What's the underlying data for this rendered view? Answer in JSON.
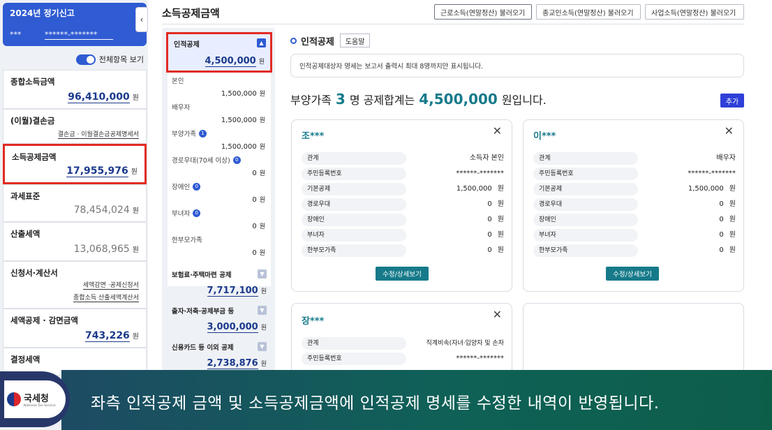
{
  "sidebar": {
    "year_title": "2024년 정기신고",
    "masked_name": "***",
    "masked_id": "******-*******",
    "toggle_label": "전체항목 보기",
    "collapse_glyph": "‹",
    "items": [
      {
        "label": "종합소득금액",
        "amount": "96,410,000",
        "unit": "원"
      },
      {
        "label": "(이월)결손금",
        "sub": "결손금 · 이월결손금공제명세서"
      },
      {
        "label": "소득공제금액",
        "amount": "17,955,976",
        "unit": "원"
      },
      {
        "label": "과세표준",
        "amount": "78,454,024",
        "unit": "원"
      },
      {
        "label": "산출세액",
        "amount": "13,068,965",
        "unit": "원"
      },
      {
        "label": "신청서·계산서",
        "sub1": "세액감면 ·공제신청서",
        "sub2": "종합소득 산출세액계산서"
      },
      {
        "label": "세액공제 · 감면금액",
        "amount": "743,226",
        "unit": "원"
      },
      {
        "label": "결정세액"
      }
    ]
  },
  "header": {
    "title": "소득공제금액",
    "btn1": "근로소득(연말정산) 불러오기",
    "btn2": "종교인소득(연말정산) 불러오기",
    "btn3": "사업소득(연말정산) 불러오기"
  },
  "mid": {
    "head_title": "인적공제",
    "head_amount": "4,500,000",
    "unit": "원",
    "up_glyph": "▲",
    "down_glyph": "▼",
    "subs": [
      {
        "label": "본인",
        "value": "1,500,000"
      },
      {
        "label": "배우자",
        "value": "1,500,000"
      },
      {
        "label": "부양가족",
        "badge": "1",
        "value": "1,500,000"
      },
      {
        "label": "경로우대(70세 이상)",
        "badge": "0",
        "value": "0"
      },
      {
        "label": "장애인",
        "badge": "0",
        "value": "0"
      },
      {
        "label": "부녀자",
        "badge": "0",
        "value": "0"
      },
      {
        "label": "한부모가족",
        "value": "0"
      }
    ],
    "cats": [
      {
        "label": "보험료·주택마련 공제",
        "value": "7,717,100"
      },
      {
        "label": "출자·저축·공제부금 등",
        "value": "3,000,000"
      },
      {
        "label": "신용카드 등 이외 공제",
        "value": "2,738,876"
      }
    ]
  },
  "detail": {
    "section_title": "인적공제",
    "help_label": "도움말",
    "notice": "인적공제대상자 명세는 보고서 출력시 최대 8명까지만 표시됩니다.",
    "summary_pre": "부양가족",
    "summary_count": "3",
    "summary_mid": "명 공제합계는",
    "summary_total": "4,500,000",
    "summary_post": "원입니다.",
    "add_label": "추가",
    "close_glyph": "✕",
    "edit_label": "수정/상세보기",
    "row_labels": [
      "관계",
      "주민등록번호",
      "기본공제",
      "경로우대",
      "장애인",
      "부녀자",
      "한부모가족"
    ],
    "unit": "원",
    "cards": [
      {
        "name": "조***",
        "relation": "소득자 본인",
        "rrn": "******-*******",
        "vals": [
          "1,500,000",
          "0",
          "0",
          "0",
          "0"
        ]
      },
      {
        "name": "이***",
        "relation": "배우자",
        "rrn": "******-*******",
        "vals": [
          "1,500,000",
          "0",
          "0",
          "0",
          "0"
        ]
      },
      {
        "name": "장***",
        "relation": "직계비속(자녀·입양자 및 손자",
        "rrn": "******-*******"
      }
    ]
  },
  "caption": {
    "text": "좌측 인적공제 금액 및 소득공제금액에 인적공제 명세를 수정한 내역이 반영됩니다.",
    "logo_kr": "국세청",
    "logo_en": "National Tax Service"
  }
}
